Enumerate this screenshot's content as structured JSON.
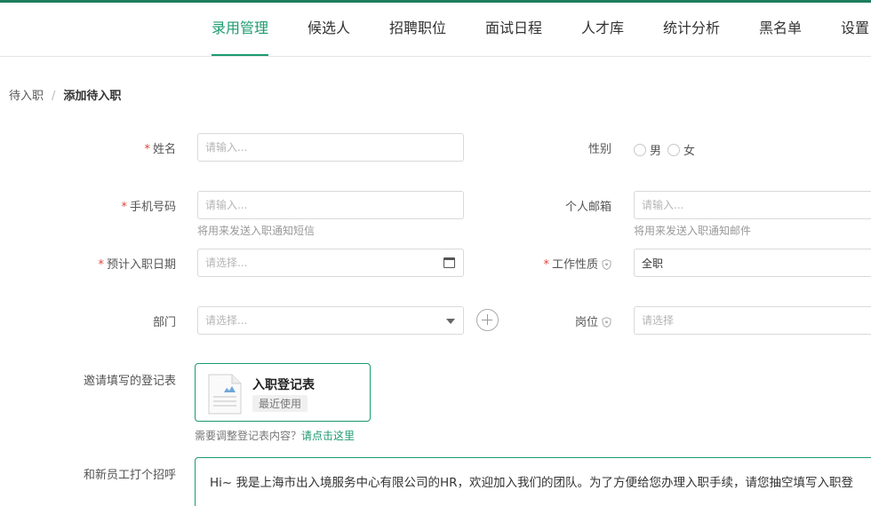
{
  "nav": {
    "items": [
      {
        "label": "录用管理",
        "active": true
      },
      {
        "label": "候选人",
        "active": false
      },
      {
        "label": "招聘职位",
        "active": false
      },
      {
        "label": "面试日程",
        "active": false
      },
      {
        "label": "人才库",
        "active": false
      },
      {
        "label": "统计分析",
        "active": false
      },
      {
        "label": "黑名单",
        "active": false
      },
      {
        "label": "设置",
        "active": false
      }
    ]
  },
  "breadcrumb": {
    "parent": "待入职",
    "separator": "/",
    "current": "添加待入职"
  },
  "form": {
    "required_mark": "*",
    "name": {
      "label": "姓名",
      "placeholder": "请输入..."
    },
    "gender": {
      "label": "性别",
      "options": [
        "男",
        "女"
      ]
    },
    "phone": {
      "label": "手机号码",
      "placeholder": "请输入...",
      "hint": "将用来发送入职通知短信"
    },
    "email": {
      "label": "个人邮箱",
      "placeholder": "请输入...",
      "hint": "将用来发送入职通知邮件"
    },
    "entry_date": {
      "label": "预计入职日期",
      "placeholder": "请选择...",
      "icon": "calendar-icon"
    },
    "job_type": {
      "label": "工作性质",
      "value": "全职",
      "icon": "shield-icon"
    },
    "department": {
      "label": "部门",
      "placeholder": "请选择...",
      "icon": "caret-down-icon"
    },
    "position": {
      "label": "岗位",
      "placeholder": "请选择",
      "icon": "shield-icon"
    },
    "invite_form": {
      "label": "邀请填写的登记表",
      "card_title": "入职登记表",
      "card_badge": "最近使用",
      "adjust_text": "需要调整登记表内容？",
      "adjust_link": "请点击这里"
    },
    "greeting": {
      "label": "和新员工打个招呼",
      "text": "Hi~ 我是上海市出入境服务中心有限公司的HR，欢迎加入我们的团队。为了方便给您办理入职手续，请您抽空填写入职登"
    }
  },
  "colors": {
    "accent": "#1c9a6e",
    "topbar": "#1c7d5b",
    "required": "#e0443a"
  }
}
